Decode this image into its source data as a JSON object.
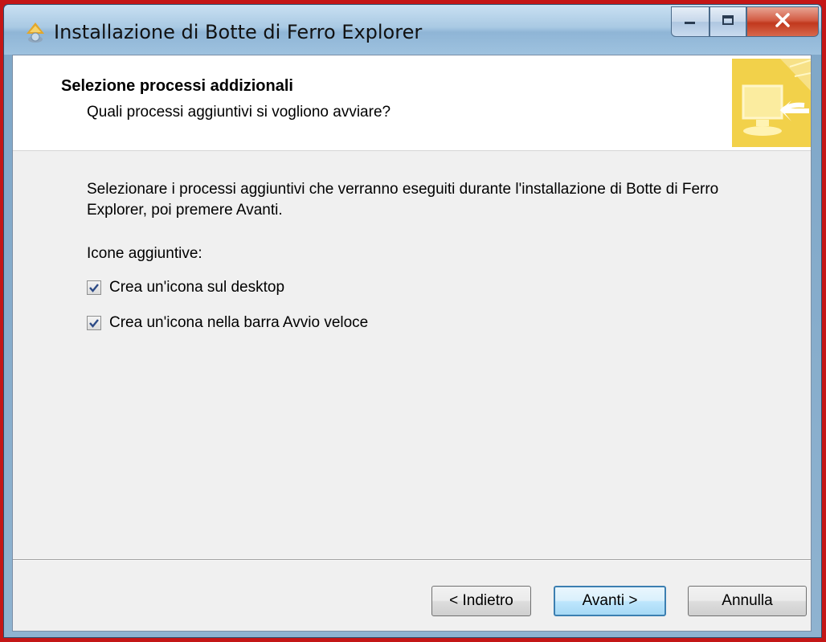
{
  "window": {
    "title": "Installazione di Botte di Ferro Explorer",
    "app_icon": "installer-icon",
    "controls": {
      "minimize": "minimize-icon",
      "maximize": "maximize-icon",
      "close": "close-icon"
    }
  },
  "header": {
    "title": "Selezione processi addizionali",
    "subtitle": "Quali processi aggiuntivi si vogliono avviare?",
    "image": "setup-wizard-image"
  },
  "body": {
    "description": "Selezionare i processi aggiuntivi che verranno eseguiti durante l'installazione di Botte di Ferro Explorer, poi premere Avanti.",
    "group_label": "Icone aggiuntive:",
    "tasks": [
      {
        "label": "Crea un'icona sul desktop",
        "checked": true
      },
      {
        "label": "Crea un'icona nella barra Avvio veloce",
        "checked": true
      }
    ]
  },
  "buttons": {
    "back": "< Indietro",
    "next": "Avanti >",
    "cancel": "Annulla"
  },
  "colors": {
    "accent_default_button": "#3c7fb1",
    "wizard_image": "#f2d14a",
    "close_button": "#c1381d"
  }
}
